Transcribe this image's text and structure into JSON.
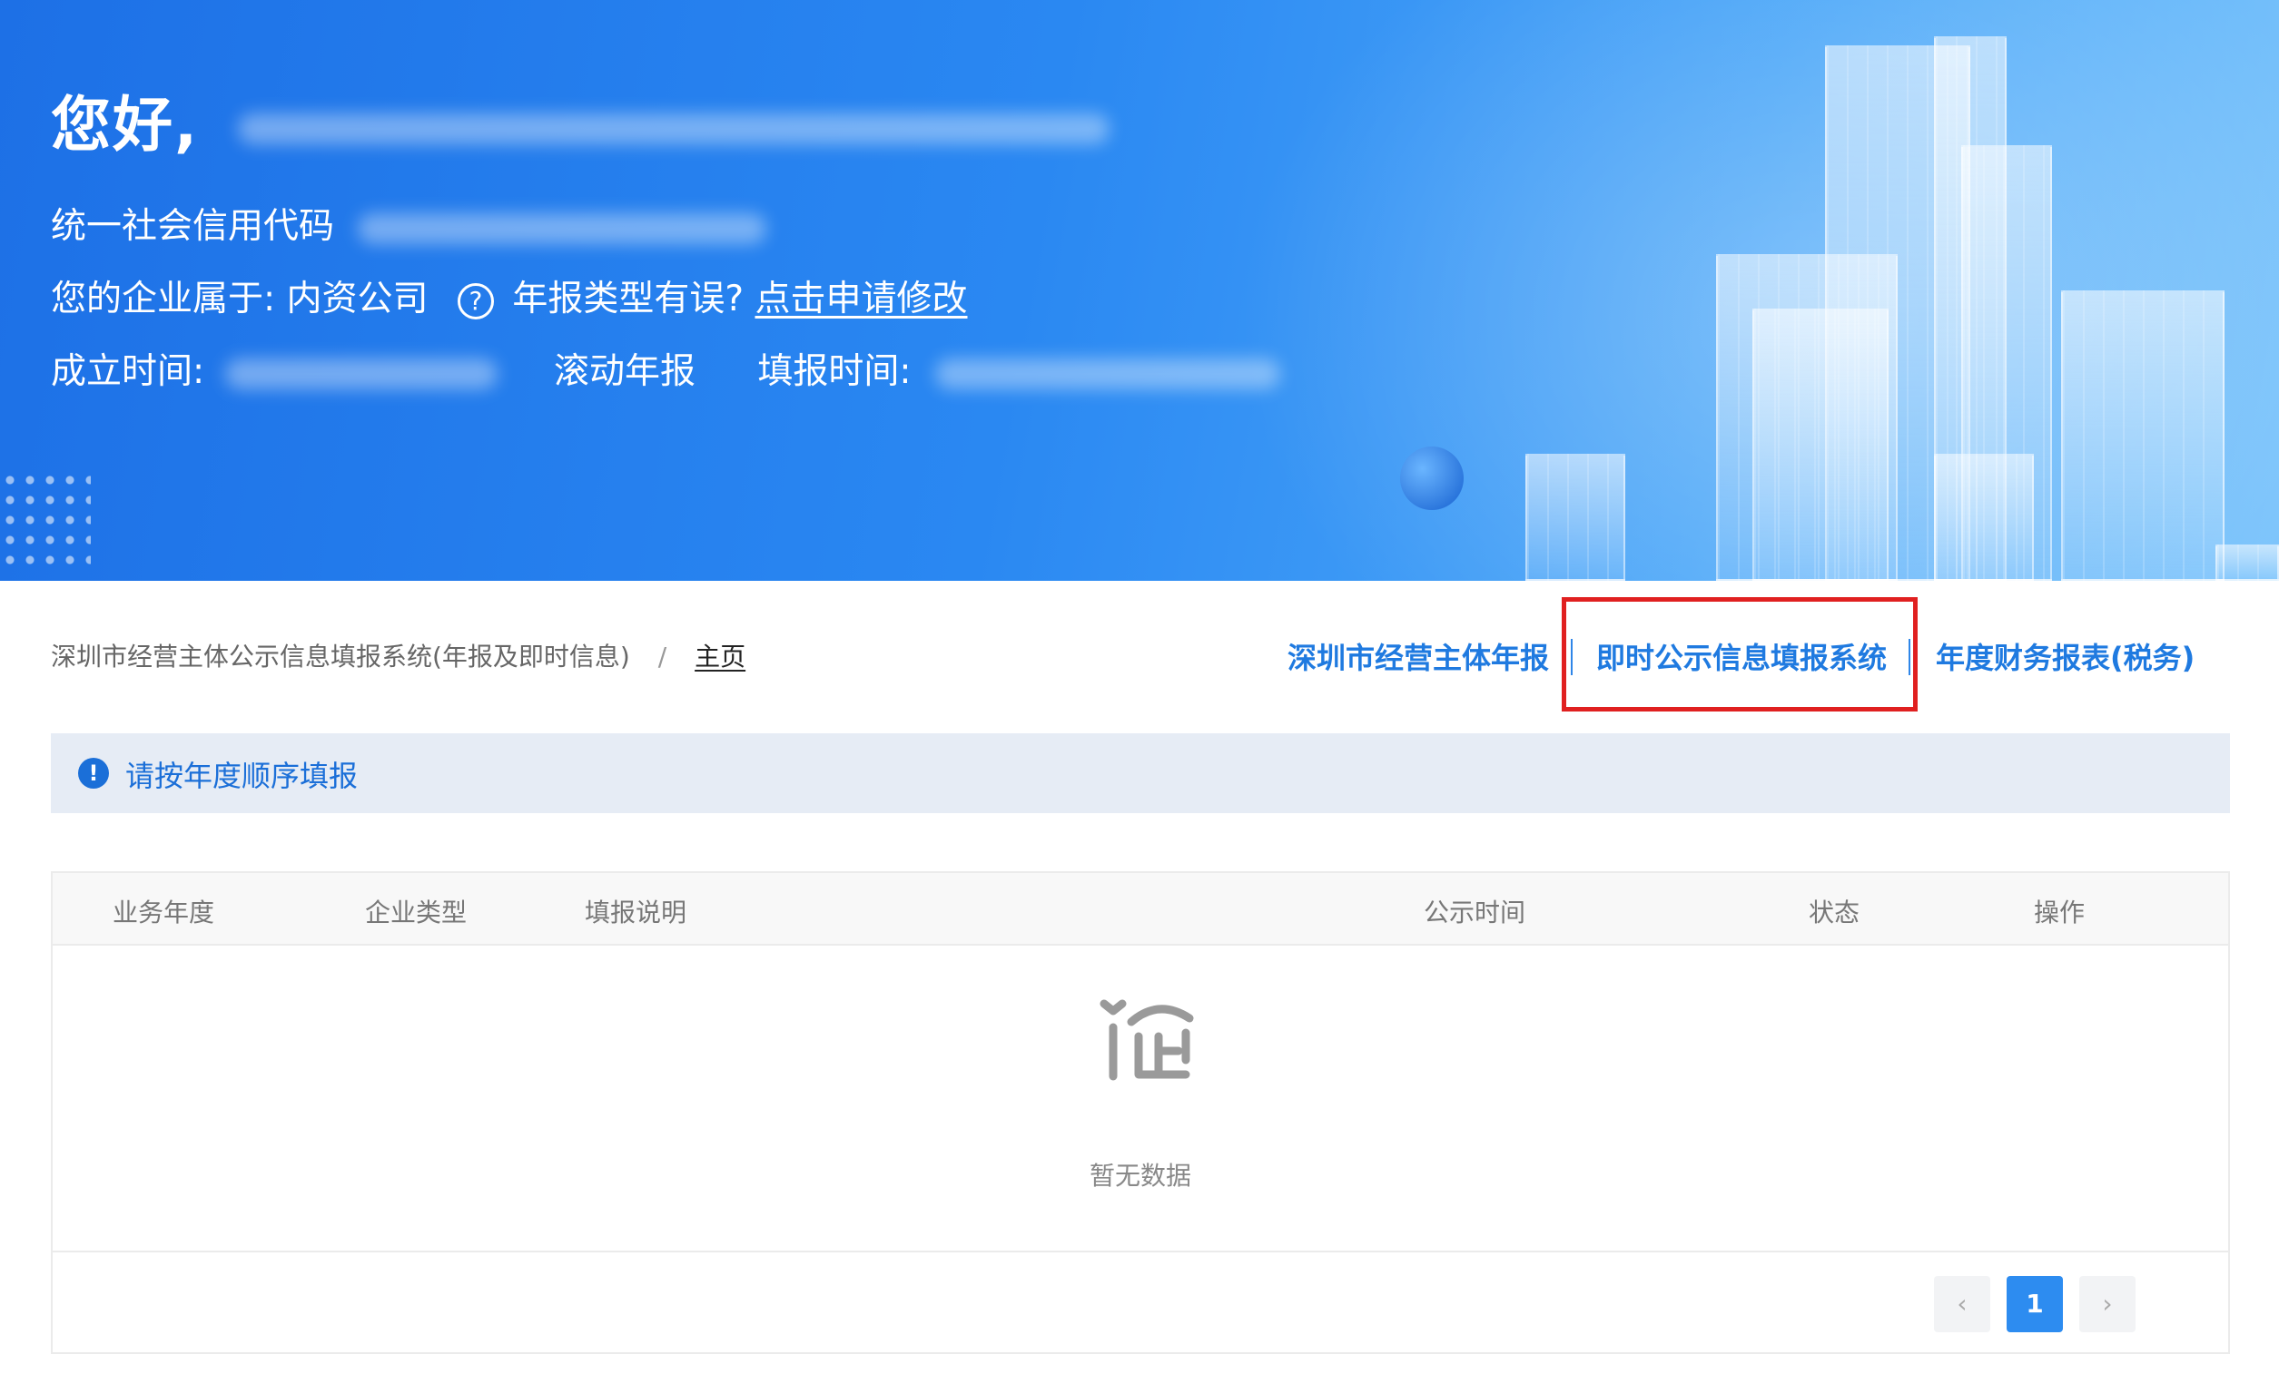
{
  "banner": {
    "greeting": "您好,",
    "credit_code_label": "统一社会信用代码",
    "company_type_label": "您的企业属于:",
    "company_type_value": "内资公司",
    "report_type_question": "年报类型有误?",
    "modify_link": "点击申请修改",
    "established_label": "成立时间:",
    "rolling_report": "滚动年报",
    "fill_time_label": "填报时间:"
  },
  "breadcrumb": {
    "system": "深圳市经营主体公示信息填报系统(年报及即时信息)",
    "separator": "/",
    "home": "主页"
  },
  "top_links": [
    {
      "label": "深圳市经营主体年报"
    },
    {
      "label": "即时公示信息填报系统"
    },
    {
      "label": "年度财务报表(税务)"
    }
  ],
  "notice": {
    "icon": "!",
    "text": "请按年度顺序填报"
  },
  "table": {
    "columns": [
      "业务年度",
      "企业类型",
      "填报说明",
      "公示时间",
      "状态",
      "操作"
    ],
    "rows": [],
    "empty_text": "暂无数据"
  },
  "pagination": {
    "prev": "‹",
    "current": "1",
    "next": "›"
  },
  "colors": {
    "accent": "#1f7ae0",
    "highlight_box": "#e02020",
    "notice_bg": "#e6ecf5",
    "page_active": "#2d8cf0"
  }
}
